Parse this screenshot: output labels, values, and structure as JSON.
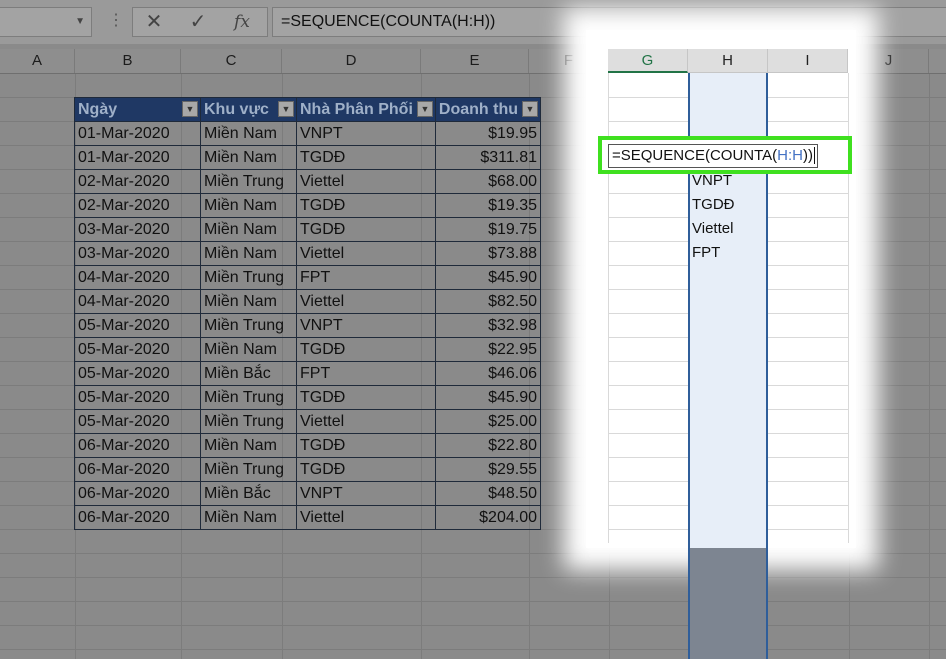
{
  "formula_bar": {
    "cancel_icon": "✕",
    "enter_icon": "✓",
    "fx_label": "fx",
    "formula": "=SEQUENCE(COUNTA(H:H))"
  },
  "columns": [
    "A",
    "B",
    "C",
    "D",
    "E",
    "F",
    "G",
    "H",
    "I",
    "J"
  ],
  "table": {
    "headers": [
      "Ngày",
      "Khu vực",
      "Nhà Phân Phối",
      "Doanh thu"
    ],
    "rows": [
      [
        "01-Mar-2020",
        "Miền Nam",
        "VNPT",
        "$19.95"
      ],
      [
        "01-Mar-2020",
        "Miền Nam",
        "TGDĐ",
        "$311.81"
      ],
      [
        "02-Mar-2020",
        "Miền Trung",
        "Viettel",
        "$68.00"
      ],
      [
        "02-Mar-2020",
        "Miền Nam",
        "TGDĐ",
        "$19.35"
      ],
      [
        "03-Mar-2020",
        "Miền Nam",
        "TGDĐ",
        "$19.75"
      ],
      [
        "03-Mar-2020",
        "Miền Nam",
        "Viettel",
        "$73.88"
      ],
      [
        "04-Mar-2020",
        "Miền Trung",
        "FPT",
        "$45.90"
      ],
      [
        "04-Mar-2020",
        "Miền Nam",
        "Viettel",
        "$82.50"
      ],
      [
        "05-Mar-2020",
        "Miền Trung",
        "VNPT",
        "$32.98"
      ],
      [
        "05-Mar-2020",
        "Miền Nam",
        "TGDĐ",
        "$22.95"
      ],
      [
        "05-Mar-2020",
        "Miền Bắc",
        "FPT",
        "$46.06"
      ],
      [
        "05-Mar-2020",
        "Miền Trung",
        "TGDĐ",
        "$45.90"
      ],
      [
        "05-Mar-2020",
        "Miền Trung",
        "Viettel",
        "$25.00"
      ],
      [
        "06-Mar-2020",
        "Miền Nam",
        "TGDĐ",
        "$22.80"
      ],
      [
        "06-Mar-2020",
        "Miền Trung",
        "TGDĐ",
        "$29.55"
      ],
      [
        "06-Mar-2020",
        "Miền Bắc",
        "VNPT",
        "$48.50"
      ],
      [
        "06-Mar-2020",
        "Miền Nam",
        "Viettel",
        "$204.00"
      ]
    ]
  },
  "column_h_values": [
    "VNPT",
    "TGDĐ",
    "Viettel",
    "FPT"
  ],
  "cell_editor": {
    "prefix": "=SEQUENCE(COUNTA(",
    "ref": "H:H",
    "suffix": "))"
  },
  "colors": {
    "highlight_border": "#3fe01f",
    "table_header": "#1f3864",
    "ref_blue": "#4472c4"
  }
}
